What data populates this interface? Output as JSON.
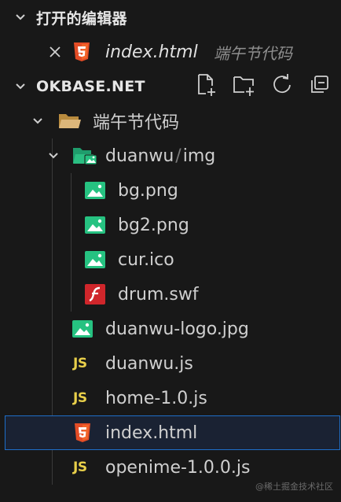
{
  "open_editors": {
    "title": "打开的编辑器",
    "items": [
      {
        "filename": "index.html",
        "folder": "端午节代码",
        "icon": "html5-icon"
      }
    ]
  },
  "explorer": {
    "title": "OKBASE.NET",
    "actions": [
      "new-file-icon",
      "new-folder-icon",
      "refresh-icon",
      "collapse-all-icon"
    ],
    "root_folder": "端午节代码",
    "sub_folder_a": "duanwu",
    "sub_folder_sep": "/",
    "sub_folder_b": "img",
    "files": {
      "bg": "bg.png",
      "bg2": "bg2.png",
      "cur": "cur.ico",
      "drum": "drum.swf",
      "logo": "duanwu-logo.jpg",
      "duanwu_js": "duanwu.js",
      "home_js": "home-1.0.js",
      "index_html": "index.html",
      "openime_js": "openime-1.0.0.js"
    },
    "js_badge": "JS"
  },
  "watermark": "@稀土掘金技术社区",
  "colors": {
    "background": "#181818",
    "selection_border": "#1e6ec8",
    "html_orange": "#e44d26",
    "image_green": "#26c281",
    "js_yellow": "#e8cf4a",
    "flash_red": "#d0262b"
  }
}
